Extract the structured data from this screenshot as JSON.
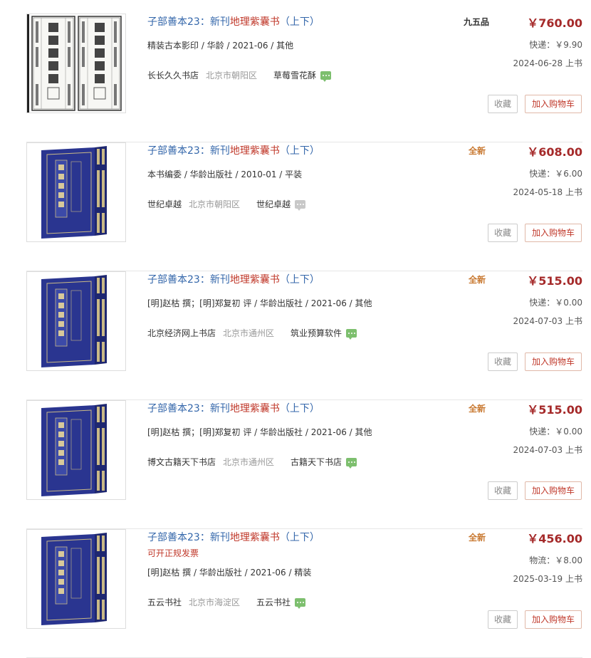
{
  "listings": [
    {
      "title_prefix": "子部善本23：新刊",
      "title_keyword": "地理紫囊书",
      "title_suffix": "（上下）",
      "invoice": "",
      "meta": "精装古本影印 / 华龄 / 2021-06 / 其他",
      "shop_name": "长长久久书店",
      "shop_location": "北京市朝阳区",
      "seller": "草莓雪花酥",
      "chat_active": true,
      "condition": "九五品",
      "price": "￥760.00",
      "shipping": "快递：￥9.90",
      "listed": "2024-06-28 上书",
      "fav_label": "收藏",
      "cart_label": "加入购物车",
      "image": "open-books"
    },
    {
      "title_prefix": "子部善本23：新刊",
      "title_keyword": "地理紫囊书",
      "title_suffix": "（上下）",
      "invoice": "",
      "meta": "本书编委 / 华龄出版社 / 2010-01 / 平装",
      "shop_name": "世纪卓越",
      "shop_location": "北京市朝阳区",
      "seller": "世纪卓越",
      "chat_active": false,
      "condition": "全新",
      "price": "￥608.00",
      "shipping": "快递：￥6.00",
      "listed": "2024-05-18 上书",
      "fav_label": "收藏",
      "cart_label": "加入购物车",
      "image": "blue-box"
    },
    {
      "title_prefix": "子部善本23：新刊",
      "title_keyword": "地理紫囊书",
      "title_suffix": "（上下）",
      "invoice": "",
      "meta": "[明]赵枯 撰；[明]郑复初 评 / 华龄出版社 / 2021-06 / 其他",
      "shop_name": "北京经济网上书店",
      "shop_location": "北京市通州区",
      "seller": "筑业预算软件",
      "chat_active": true,
      "condition": "全新",
      "price": "￥515.00",
      "shipping": "快递：￥0.00",
      "listed": "2024-07-03 上书",
      "fav_label": "收藏",
      "cart_label": "加入购物车",
      "image": "blue-box"
    },
    {
      "title_prefix": "子部善本23：新刊",
      "title_keyword": "地理紫囊书",
      "title_suffix": "（上下）",
      "invoice": "",
      "meta": "[明]赵枯 撰；[明]郑复初 评 / 华龄出版社 / 2021-06 / 其他",
      "shop_name": "博文古籍天下书店",
      "shop_location": "北京市通州区",
      "seller": "古籍天下书店",
      "chat_active": true,
      "condition": "全新",
      "price": "￥515.00",
      "shipping": "快递：￥0.00",
      "listed": "2024-07-03 上书",
      "fav_label": "收藏",
      "cart_label": "加入购物车",
      "image": "blue-box"
    },
    {
      "title_prefix": "子部善本23：新刊",
      "title_keyword": "地理紫囊书",
      "title_suffix": "（上下）",
      "invoice": "可开正规发票",
      "meta": "[明]赵枯 撰 / 华龄出版社 / 2021-06 / 精装",
      "shop_name": "五云书社",
      "shop_location": "北京市海淀区",
      "seller": "五云书社",
      "chat_active": true,
      "condition": "全新",
      "price": "￥456.00",
      "shipping": "物流：￥8.00",
      "listed": "2025-03-19 上书",
      "fav_label": "收藏",
      "cart_label": "加入购物车",
      "image": "blue-box"
    }
  ]
}
